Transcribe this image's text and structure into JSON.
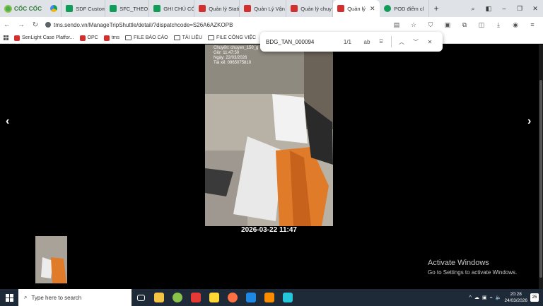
{
  "browser": {
    "brand": "CỐC CỐC",
    "tabs": [
      {
        "label": "",
        "icon": "google-drive-icon"
      },
      {
        "label": "SDF Custome",
        "icon": "sheets-icon"
      },
      {
        "label": "SFC_THEO D",
        "icon": "sheets-icon"
      },
      {
        "label": "GHI CHÚ CÓ",
        "icon": "sheets-icon"
      },
      {
        "label": "Quản lý Stati",
        "icon": "sendo-icon"
      },
      {
        "label": "Quản Lý Vận",
        "icon": "sendo-icon"
      },
      {
        "label": "Quản lý chuy",
        "icon": "sendo-icon"
      },
      {
        "label": "Quản lý",
        "icon": "sendo-icon",
        "active": true
      },
      {
        "label": "POD điểm cl",
        "icon": "pod-icon"
      }
    ],
    "url": "tms.sendo.vn/ManageTripShuttle/detail/?dispatchcode=S26A6AZKOPB",
    "bookmarks": [
      {
        "label": "SenLight Case Platfor...",
        "type": "site"
      },
      {
        "label": "OPC",
        "type": "site"
      },
      {
        "label": "tms",
        "type": "site"
      },
      {
        "label": "FILE BÁO CÁO",
        "type": "folder"
      },
      {
        "label": "TÀI LIỆU",
        "type": "folder"
      },
      {
        "label": "FILE CÔNG VIỆC",
        "type": "folder"
      }
    ]
  },
  "find": {
    "query": "BDG_TAN_000094",
    "count": "1/1",
    "case_label": "ab"
  },
  "viewer": {
    "overlay": [
      "Chuyến: chuyen_150_g",
      "Giờ: 11:47:50",
      "Ngày: 22/03/2026",
      "Tài xế: 0965075810"
    ],
    "caption": "2026-03-22 11:47",
    "prev": "‹",
    "next": "›"
  },
  "watermark": {
    "line1": "Activate Windows",
    "line2": "Go to Settings to activate Windows."
  },
  "taskbar": {
    "search_placeholder": "Type here to search",
    "time": "20:28",
    "date": "24/03/2026",
    "notif_count": "25"
  }
}
